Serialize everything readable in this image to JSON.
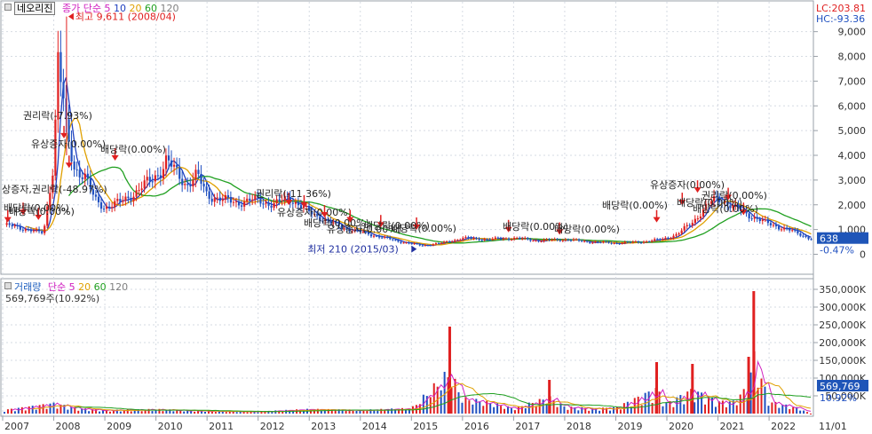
{
  "price_panel": {
    "name": "네오리진",
    "ma_label": "종가 단순",
    "ma_periods": [
      "5",
      "10",
      "20",
      "60",
      "120"
    ],
    "ma_colors": [
      "#d020c0",
      "#2040c0",
      "#e0a000",
      "#20a020",
      "#808080"
    ],
    "lc_label": "LC:203.81",
    "hc_label": "HC:-93.36",
    "current_price": "638",
    "current_change": "-0.47%",
    "high_annotation": "최고 9,611 (2008/04)",
    "low_annotation": "최저 210 (2015/03)",
    "y_ticks": [
      "9,000",
      "8,000",
      "7,000",
      "6,000",
      "5,000",
      "4,000",
      "3,000",
      "2,000",
      "1,000",
      "0"
    ],
    "events": [
      "권리락(-7.93%)",
      "유상증자(0.00%)",
      "배당락(0.00%)",
      "상증자,권리락(-48.97%)",
      "배당락(0.00%)",
      "배당락(0.00%)",
      "권리락(-11.36%)",
      "유상증자(0.00%)",
      "배당락(0.00%)",
      "유상증자(0.00%)",
      "배당락(0.00%)",
      "배당락(0.00%)",
      "배당락(0.00%)",
      "배당락(0.00%)",
      "배당락(0.00%)",
      "유상증자(0.00%)",
      "배당락(0.00%)",
      "권리락(0.00%)",
      "배당락(0.00%)"
    ]
  },
  "volume_panel": {
    "name": "거래량",
    "ma_label": "단순",
    "ma_periods": [
      "5",
      "20",
      "60",
      "120"
    ],
    "ma_colors": [
      "#d020c0",
      "#e0a000",
      "#20a020",
      "#808080"
    ],
    "last_volume": "569,769주(10.92%)",
    "current_volume": "569,769",
    "current_pct": "10.92%",
    "y_ticks": [
      "350,000K",
      "300,000K",
      "250,000K",
      "200,000K",
      "150,000K",
      "100,000K",
      "50,000K"
    ]
  },
  "x_axis": {
    "years": [
      "2007",
      "2008",
      "2009",
      "2010",
      "2011",
      "2012",
      "2013",
      "2014",
      "2015",
      "2016",
      "2017",
      "2018",
      "2019",
      "2020",
      "2021",
      "2022"
    ],
    "right_label": "11/01"
  },
  "chart_data": {
    "type": "line",
    "title": "",
    "y_unit": "원",
    "ylim": [
      0,
      9611
    ],
    "series": [
      {
        "name": "종가",
        "x": [
          2007.0,
          2007.5,
          2007.8,
          2008.0,
          2008.08,
          2008.17,
          2008.25,
          2008.4,
          2008.6,
          2008.8,
          2009.0,
          2009.3,
          2009.6,
          2009.9,
          2010.1,
          2010.2,
          2010.4,
          2010.6,
          2010.8,
          2011.0,
          2011.3,
          2011.6,
          2012.0,
          2012.3,
          2012.6,
          2013.0,
          2013.3,
          2013.6,
          2014.0,
          2014.4,
          2014.8,
          2015.2,
          2015.6,
          2016.0,
          2016.5,
          2017.0,
          2017.5,
          2018.0,
          2018.5,
          2019.0,
          2019.5,
          2019.9,
          2020.2,
          2020.5,
          2020.8,
          2021.0,
          2021.3,
          2021.6,
          2021.9,
          2022.2,
          2022.5,
          2022.8
        ],
        "values": [
          1200,
          1000,
          850,
          3800,
          8000,
          6500,
          4800,
          3500,
          3200,
          2200,
          1900,
          2100,
          2500,
          3000,
          3400,
          3800,
          3300,
          2800,
          3200,
          2400,
          2200,
          2100,
          2200,
          2000,
          2300,
          1700,
          1400,
          1100,
          900,
          700,
          500,
          350,
          450,
          650,
          600,
          650,
          550,
          600,
          500,
          450,
          500,
          600,
          800,
          1300,
          2000,
          2300,
          1900,
          1600,
          1300,
          1100,
          900,
          638
        ]
      },
      {
        "name": "거래량",
        "x": [
          2007.0,
          2008.0,
          2008.5,
          2009.0,
          2010.0,
          2011.0,
          2012.0,
          2013.0,
          2014.0,
          2015.0,
          2015.75,
          2016.0,
          2016.6,
          2017.0,
          2017.7,
          2018.0,
          2018.5,
          2019.0,
          2019.8,
          2020.0,
          2020.5,
          2021.0,
          2021.3,
          2021.6,
          2021.7,
          2022.0,
          2022.6,
          2022.8
        ],
        "values": [
          20000,
          60000,
          30000,
          20000,
          25000,
          15000,
          12000,
          25000,
          20000,
          30000,
          245000,
          90000,
          60000,
          30000,
          95000,
          40000,
          30000,
          35000,
          145000,
          60000,
          140000,
          70000,
          70000,
          160000,
          345000,
          70000,
          30000,
          569.769
        ]
      }
    ]
  }
}
